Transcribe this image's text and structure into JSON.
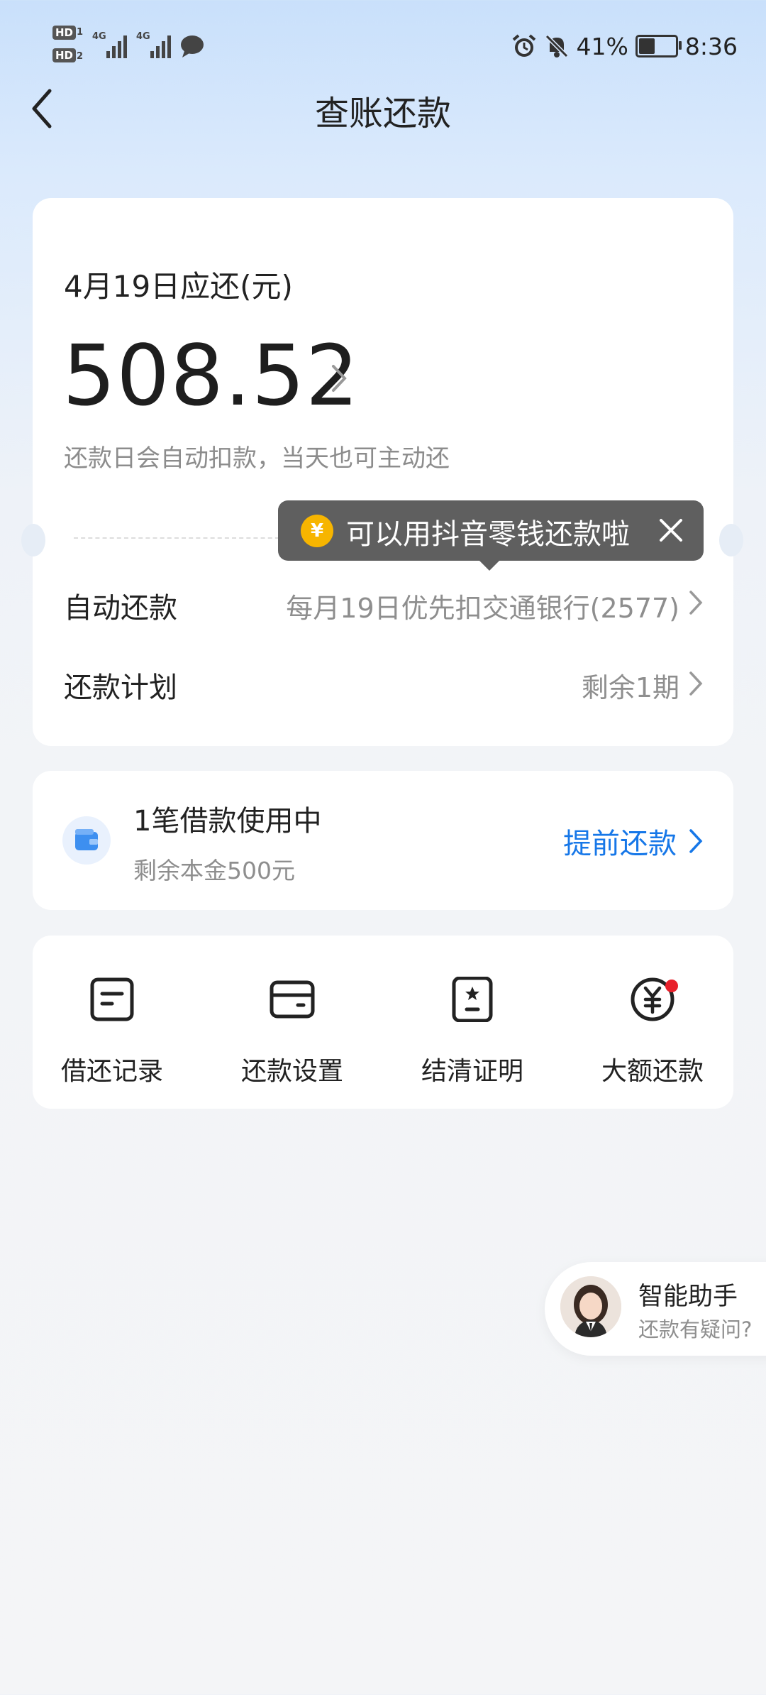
{
  "status_bar": {
    "hd1": "HD",
    "sim1": "1",
    "hd2": "HD",
    "sim2": "2",
    "net1": "4G",
    "net2": "4G",
    "battery": "41%",
    "battery_level": 0.41,
    "time": "8:36"
  },
  "header": {
    "title": "查账还款"
  },
  "bill": {
    "due_label": "4月19日应还(元)",
    "amount": "508.52",
    "hint": "还款日会自动扣款，当天也可主动还"
  },
  "tooltip": {
    "icon": "¥",
    "text": "可以用抖音零钱还款啦"
  },
  "rows": [
    {
      "label": "自动还款",
      "value": "每月19日优先扣交通银行(2577)"
    },
    {
      "label": "还款计划",
      "value": "剩余1期"
    }
  ],
  "loan": {
    "title": "1笔借款使用中",
    "subtitle": "剩余本金500元",
    "action": "提前还款"
  },
  "quick_actions": [
    {
      "label": "借还记录",
      "icon": "record-icon"
    },
    {
      "label": "还款设置",
      "icon": "card-icon"
    },
    {
      "label": "结清证明",
      "icon": "certificate-icon"
    },
    {
      "label": "大额还款",
      "icon": "yuan-icon"
    }
  ],
  "assistant": {
    "name": "智能助手",
    "subtitle": "还款有疑问?"
  },
  "colors": {
    "accent": "#1677e8",
    "badge": "#e8202a",
    "coin": "#f7b500"
  }
}
